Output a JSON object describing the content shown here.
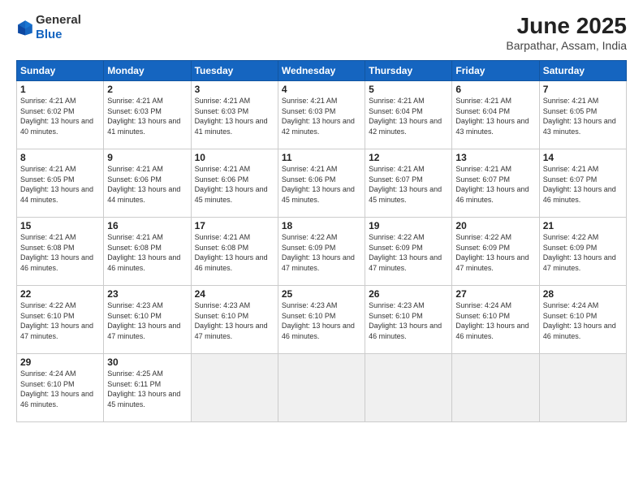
{
  "header": {
    "logo_general": "General",
    "logo_blue": "Blue",
    "month_title": "June 2025",
    "location": "Barpathar, Assam, India"
  },
  "days_of_week": [
    "Sunday",
    "Monday",
    "Tuesday",
    "Wednesday",
    "Thursday",
    "Friday",
    "Saturday"
  ],
  "weeks": [
    [
      {
        "num": "1",
        "rise": "4:21 AM",
        "set": "6:02 PM",
        "daylight": "13 hours and 40 minutes."
      },
      {
        "num": "2",
        "rise": "4:21 AM",
        "set": "6:03 PM",
        "daylight": "13 hours and 41 minutes."
      },
      {
        "num": "3",
        "rise": "4:21 AM",
        "set": "6:03 PM",
        "daylight": "13 hours and 41 minutes."
      },
      {
        "num": "4",
        "rise": "4:21 AM",
        "set": "6:03 PM",
        "daylight": "13 hours and 42 minutes."
      },
      {
        "num": "5",
        "rise": "4:21 AM",
        "set": "6:04 PM",
        "daylight": "13 hours and 42 minutes."
      },
      {
        "num": "6",
        "rise": "4:21 AM",
        "set": "6:04 PM",
        "daylight": "13 hours and 43 minutes."
      },
      {
        "num": "7",
        "rise": "4:21 AM",
        "set": "6:05 PM",
        "daylight": "13 hours and 43 minutes."
      }
    ],
    [
      {
        "num": "8",
        "rise": "4:21 AM",
        "set": "6:05 PM",
        "daylight": "13 hours and 44 minutes."
      },
      {
        "num": "9",
        "rise": "4:21 AM",
        "set": "6:06 PM",
        "daylight": "13 hours and 44 minutes."
      },
      {
        "num": "10",
        "rise": "4:21 AM",
        "set": "6:06 PM",
        "daylight": "13 hours and 45 minutes."
      },
      {
        "num": "11",
        "rise": "4:21 AM",
        "set": "6:06 PM",
        "daylight": "13 hours and 45 minutes."
      },
      {
        "num": "12",
        "rise": "4:21 AM",
        "set": "6:07 PM",
        "daylight": "13 hours and 45 minutes."
      },
      {
        "num": "13",
        "rise": "4:21 AM",
        "set": "6:07 PM",
        "daylight": "13 hours and 46 minutes."
      },
      {
        "num": "14",
        "rise": "4:21 AM",
        "set": "6:07 PM",
        "daylight": "13 hours and 46 minutes."
      }
    ],
    [
      {
        "num": "15",
        "rise": "4:21 AM",
        "set": "6:08 PM",
        "daylight": "13 hours and 46 minutes."
      },
      {
        "num": "16",
        "rise": "4:21 AM",
        "set": "6:08 PM",
        "daylight": "13 hours and 46 minutes."
      },
      {
        "num": "17",
        "rise": "4:21 AM",
        "set": "6:08 PM",
        "daylight": "13 hours and 46 minutes."
      },
      {
        "num": "18",
        "rise": "4:22 AM",
        "set": "6:09 PM",
        "daylight": "13 hours and 47 minutes."
      },
      {
        "num": "19",
        "rise": "4:22 AM",
        "set": "6:09 PM",
        "daylight": "13 hours and 47 minutes."
      },
      {
        "num": "20",
        "rise": "4:22 AM",
        "set": "6:09 PM",
        "daylight": "13 hours and 47 minutes."
      },
      {
        "num": "21",
        "rise": "4:22 AM",
        "set": "6:09 PM",
        "daylight": "13 hours and 47 minutes."
      }
    ],
    [
      {
        "num": "22",
        "rise": "4:22 AM",
        "set": "6:10 PM",
        "daylight": "13 hours and 47 minutes."
      },
      {
        "num": "23",
        "rise": "4:23 AM",
        "set": "6:10 PM",
        "daylight": "13 hours and 47 minutes."
      },
      {
        "num": "24",
        "rise": "4:23 AM",
        "set": "6:10 PM",
        "daylight": "13 hours and 47 minutes."
      },
      {
        "num": "25",
        "rise": "4:23 AM",
        "set": "6:10 PM",
        "daylight": "13 hours and 46 minutes."
      },
      {
        "num": "26",
        "rise": "4:23 AM",
        "set": "6:10 PM",
        "daylight": "13 hours and 46 minutes."
      },
      {
        "num": "27",
        "rise": "4:24 AM",
        "set": "6:10 PM",
        "daylight": "13 hours and 46 minutes."
      },
      {
        "num": "28",
        "rise": "4:24 AM",
        "set": "6:10 PM",
        "daylight": "13 hours and 46 minutes."
      }
    ],
    [
      {
        "num": "29",
        "rise": "4:24 AM",
        "set": "6:10 PM",
        "daylight": "13 hours and 46 minutes."
      },
      {
        "num": "30",
        "rise": "4:25 AM",
        "set": "6:11 PM",
        "daylight": "13 hours and 45 minutes."
      },
      null,
      null,
      null,
      null,
      null
    ]
  ]
}
